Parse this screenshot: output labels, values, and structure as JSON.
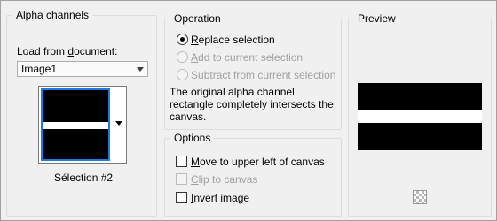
{
  "alpha_channels": {
    "title": "Alpha channels",
    "load_label_pre": "Load from ",
    "load_label_u": "d",
    "load_label_post": "ocument:",
    "document_value": "Image1",
    "selection_name": "Sélection #2"
  },
  "operation": {
    "title": "Operation",
    "options": [
      {
        "u": "R",
        "rest": "eplace selection",
        "checked": true,
        "enabled": true
      },
      {
        "u": "A",
        "rest": "dd to current selection",
        "checked": false,
        "enabled": false
      },
      {
        "u": "S",
        "rest": "ubtract from current selection",
        "checked": false,
        "enabled": false
      }
    ],
    "description": "The original alpha channel rectangle completely intersects the canvas.",
    "desc_lines": [
      "The original alpha channel",
      "rectangle completely intersects the",
      "canvas."
    ]
  },
  "options": {
    "title": "Options",
    "move_u": "M",
    "move_rest": "ove to upper left of canvas",
    "clip_u": "C",
    "clip_rest": "lip to canvas",
    "invert_u": "I",
    "invert_rest": "nvert image",
    "move_checked": false,
    "clip_checked": false,
    "invert_checked": false
  },
  "preview": {
    "title": "Preview",
    "transparency_icon": "checkerboard-icon"
  },
  "colors": {
    "dialog_bg": "#f0f0f0",
    "selection_border": "#1e7ae0"
  }
}
